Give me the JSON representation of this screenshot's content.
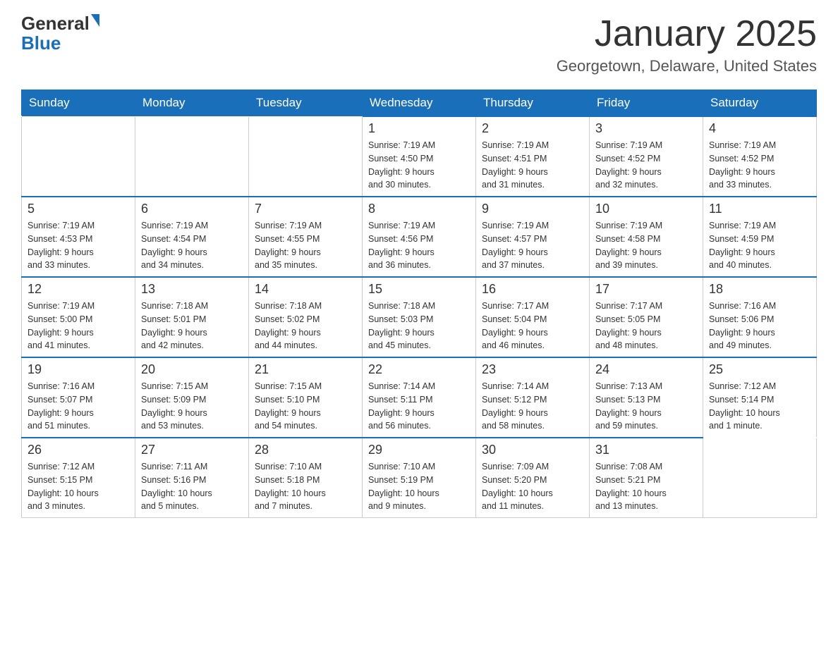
{
  "header": {
    "logo_general": "General",
    "logo_blue": "Blue",
    "title": "January 2025",
    "subtitle": "Georgetown, Delaware, United States"
  },
  "days_of_week": [
    "Sunday",
    "Monday",
    "Tuesday",
    "Wednesday",
    "Thursday",
    "Friday",
    "Saturday"
  ],
  "weeks": [
    [
      {
        "day": "",
        "info": ""
      },
      {
        "day": "",
        "info": ""
      },
      {
        "day": "",
        "info": ""
      },
      {
        "day": "1",
        "info": "Sunrise: 7:19 AM\nSunset: 4:50 PM\nDaylight: 9 hours\nand 30 minutes."
      },
      {
        "day": "2",
        "info": "Sunrise: 7:19 AM\nSunset: 4:51 PM\nDaylight: 9 hours\nand 31 minutes."
      },
      {
        "day": "3",
        "info": "Sunrise: 7:19 AM\nSunset: 4:52 PM\nDaylight: 9 hours\nand 32 minutes."
      },
      {
        "day": "4",
        "info": "Sunrise: 7:19 AM\nSunset: 4:52 PM\nDaylight: 9 hours\nand 33 minutes."
      }
    ],
    [
      {
        "day": "5",
        "info": "Sunrise: 7:19 AM\nSunset: 4:53 PM\nDaylight: 9 hours\nand 33 minutes."
      },
      {
        "day": "6",
        "info": "Sunrise: 7:19 AM\nSunset: 4:54 PM\nDaylight: 9 hours\nand 34 minutes."
      },
      {
        "day": "7",
        "info": "Sunrise: 7:19 AM\nSunset: 4:55 PM\nDaylight: 9 hours\nand 35 minutes."
      },
      {
        "day": "8",
        "info": "Sunrise: 7:19 AM\nSunset: 4:56 PM\nDaylight: 9 hours\nand 36 minutes."
      },
      {
        "day": "9",
        "info": "Sunrise: 7:19 AM\nSunset: 4:57 PM\nDaylight: 9 hours\nand 37 minutes."
      },
      {
        "day": "10",
        "info": "Sunrise: 7:19 AM\nSunset: 4:58 PM\nDaylight: 9 hours\nand 39 minutes."
      },
      {
        "day": "11",
        "info": "Sunrise: 7:19 AM\nSunset: 4:59 PM\nDaylight: 9 hours\nand 40 minutes."
      }
    ],
    [
      {
        "day": "12",
        "info": "Sunrise: 7:19 AM\nSunset: 5:00 PM\nDaylight: 9 hours\nand 41 minutes."
      },
      {
        "day": "13",
        "info": "Sunrise: 7:18 AM\nSunset: 5:01 PM\nDaylight: 9 hours\nand 42 minutes."
      },
      {
        "day": "14",
        "info": "Sunrise: 7:18 AM\nSunset: 5:02 PM\nDaylight: 9 hours\nand 44 minutes."
      },
      {
        "day": "15",
        "info": "Sunrise: 7:18 AM\nSunset: 5:03 PM\nDaylight: 9 hours\nand 45 minutes."
      },
      {
        "day": "16",
        "info": "Sunrise: 7:17 AM\nSunset: 5:04 PM\nDaylight: 9 hours\nand 46 minutes."
      },
      {
        "day": "17",
        "info": "Sunrise: 7:17 AM\nSunset: 5:05 PM\nDaylight: 9 hours\nand 48 minutes."
      },
      {
        "day": "18",
        "info": "Sunrise: 7:16 AM\nSunset: 5:06 PM\nDaylight: 9 hours\nand 49 minutes."
      }
    ],
    [
      {
        "day": "19",
        "info": "Sunrise: 7:16 AM\nSunset: 5:07 PM\nDaylight: 9 hours\nand 51 minutes."
      },
      {
        "day": "20",
        "info": "Sunrise: 7:15 AM\nSunset: 5:09 PM\nDaylight: 9 hours\nand 53 minutes."
      },
      {
        "day": "21",
        "info": "Sunrise: 7:15 AM\nSunset: 5:10 PM\nDaylight: 9 hours\nand 54 minutes."
      },
      {
        "day": "22",
        "info": "Sunrise: 7:14 AM\nSunset: 5:11 PM\nDaylight: 9 hours\nand 56 minutes."
      },
      {
        "day": "23",
        "info": "Sunrise: 7:14 AM\nSunset: 5:12 PM\nDaylight: 9 hours\nand 58 minutes."
      },
      {
        "day": "24",
        "info": "Sunrise: 7:13 AM\nSunset: 5:13 PM\nDaylight: 9 hours\nand 59 minutes."
      },
      {
        "day": "25",
        "info": "Sunrise: 7:12 AM\nSunset: 5:14 PM\nDaylight: 10 hours\nand 1 minute."
      }
    ],
    [
      {
        "day": "26",
        "info": "Sunrise: 7:12 AM\nSunset: 5:15 PM\nDaylight: 10 hours\nand 3 minutes."
      },
      {
        "day": "27",
        "info": "Sunrise: 7:11 AM\nSunset: 5:16 PM\nDaylight: 10 hours\nand 5 minutes."
      },
      {
        "day": "28",
        "info": "Sunrise: 7:10 AM\nSunset: 5:18 PM\nDaylight: 10 hours\nand 7 minutes."
      },
      {
        "day": "29",
        "info": "Sunrise: 7:10 AM\nSunset: 5:19 PM\nDaylight: 10 hours\nand 9 minutes."
      },
      {
        "day": "30",
        "info": "Sunrise: 7:09 AM\nSunset: 5:20 PM\nDaylight: 10 hours\nand 11 minutes."
      },
      {
        "day": "31",
        "info": "Sunrise: 7:08 AM\nSunset: 5:21 PM\nDaylight: 10 hours\nand 13 minutes."
      },
      {
        "day": "",
        "info": ""
      }
    ]
  ]
}
